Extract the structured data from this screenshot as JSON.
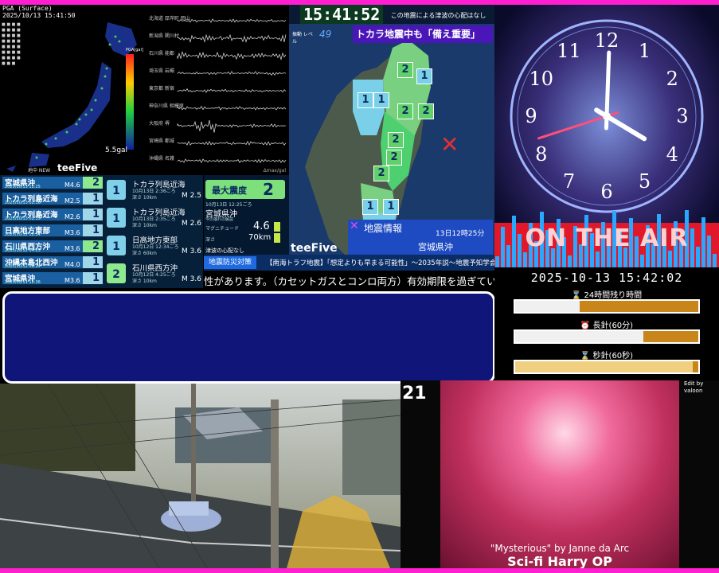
{
  "pga_panel": {
    "header_line1": "PGA (Surface)",
    "header_line2": "2025/10/13 15:41:50",
    "scale_label": "5.5gal",
    "scale_title": "PGA[gal]",
    "brand": "teeFive",
    "small_tag": "地中 NEW"
  },
  "waveform": {
    "labels": [
      "北海道 厚岸町 岡山",
      "新潟県 関川村",
      "石川県 能都",
      "埼玉県 岩槻",
      "東京都 新宿",
      "神奈川県 相模原",
      "大阪府 堺",
      "宮崎県 都城",
      "沖縄県 名護"
    ],
    "axis_label": "Δmax/gal"
  },
  "clock_bar": {
    "time": "15:41:52",
    "notice": "この地震による津波の心配はなし"
  },
  "map_panel": {
    "level_label": "振動 レベル",
    "level_value": "49",
    "headline": "トカラ地震中も「備え重要」",
    "info_label": "地震情報",
    "info_time": "13日12時25分",
    "info_place": "宮城県沖",
    "brand": "teeFive",
    "intensity_marks": [
      "2",
      "1",
      "1",
      "1",
      "2",
      "2",
      "2",
      "2",
      "2",
      "1",
      "1"
    ]
  },
  "quake_list": [
    {
      "name": "宮城県沖",
      "date": "2025/10/13 12:25",
      "mag": "M4.6",
      "scale": "2",
      "color": "#8ee88e"
    },
    {
      "name": "トカラ列島近海",
      "date": "2025/10/13 02:36",
      "mag": "M2.5",
      "scale": "1",
      "color": "#9fd6ea"
    },
    {
      "name": "トカラ列島近海",
      "date": "2025/10/13 02:35",
      "mag": "M2.6",
      "scale": "1",
      "color": "#9fd6ea"
    },
    {
      "name": "日高地方東部",
      "date": "2025/10/12 12:34",
      "mag": "M3.6",
      "scale": "1",
      "color": "#9fd6ea"
    },
    {
      "name": "石川県西方沖",
      "date": "2025/10/12 04:25",
      "mag": "M3.6",
      "scale": "2",
      "color": "#8ee88e"
    },
    {
      "name": "沖縄本島北西沖",
      "date": "2025/10/12 00:24",
      "mag": "M4.0",
      "scale": "1",
      "color": "#9fd6ea"
    },
    {
      "name": "宮城県沖",
      "date": "2025/10/11 12:36",
      "mag": "M3.6",
      "scale": "1",
      "color": "#9fd6ea"
    }
  ],
  "quake_cards": [
    {
      "place": "トカラ列島近海",
      "time": "10月13日 2:36ごろ",
      "depth": "深さ 10km",
      "mag": "M 2.5",
      "scale": "1"
    },
    {
      "place": "トカラ列島近海",
      "time": "10月13日 2:35ごろ",
      "depth": "深さ 10km",
      "mag": "M 2.6",
      "scale": "1"
    },
    {
      "place": "日高地方東部",
      "time": "10月12日 12:34ごろ",
      "depth": "深さ 60km",
      "mag": "M 3.6",
      "scale": "1"
    },
    {
      "place": "石川県西方沖",
      "time": "10月12日 4:25ごろ",
      "depth": "深さ 10km",
      "mag": "M 3.6",
      "scale": "2"
    }
  ],
  "max_panel": {
    "title": "最大震度",
    "value": "2",
    "time": "10月13日 12:25ごろ",
    "place": "宮城県沖",
    "sub": "今の揺れの解説",
    "mag_label": "マグニチュード",
    "mag_value": "4.6",
    "depth_label": "深さ",
    "depth_value": "70km",
    "tsunami": "津波の心配なし"
  },
  "news": {
    "tag": "地震防災対策",
    "headline": "【南海トラフ地震】「想定よりも早まる可能性」〜2035年説〜地震予知学会",
    "ticker": "性があります。（カセットガスとコンロ両方）有効期限を過ぎている場合"
  },
  "clock_panel": {
    "numbers": [
      "12",
      "1",
      "2",
      "3",
      "4",
      "5",
      "6",
      "7",
      "8",
      "9",
      "10",
      "11"
    ],
    "on_air": "ON THE AIR",
    "datetime": "2025-10-13 15:42:02"
  },
  "timers": [
    {
      "label": "24時間残り時間",
      "icon": "⌛",
      "progress": 0.35
    },
    {
      "label": "長針(60分)",
      "icon": "⏰",
      "progress": 0.7
    },
    {
      "label": "秒針(60秒)",
      "icon": "⌛",
      "progress": 0.97
    }
  ],
  "video": {
    "counter": "21",
    "credit": "Edit by valoon",
    "caption1": "\"Mysterious\" by Janne da Arc",
    "caption2": "Sci-fi Harry OP"
  }
}
